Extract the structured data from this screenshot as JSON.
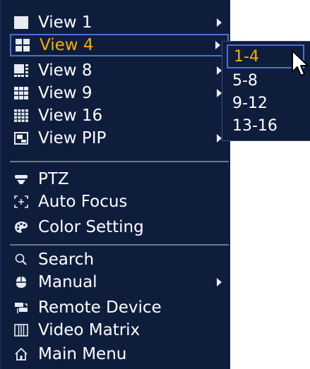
{
  "menu": {
    "items": [
      {
        "label": "View 1",
        "icon": "view-1-icon",
        "has_submenu": true
      },
      {
        "label": "View 4",
        "icon": "view-4-icon",
        "has_submenu": true,
        "active": true
      },
      {
        "label": "View 8",
        "icon": "view-8-icon",
        "has_submenu": true
      },
      {
        "label": "View 9",
        "icon": "view-9-icon",
        "has_submenu": true
      },
      {
        "label": "View 16",
        "icon": "view-16-icon",
        "has_submenu": false
      },
      {
        "label": "View PIP",
        "icon": "view-pip-icon",
        "has_submenu": true
      },
      {
        "label": "PTZ",
        "icon": "ptz-icon",
        "has_submenu": false
      },
      {
        "label": "Auto Focus",
        "icon": "auto-focus-icon",
        "has_submenu": false
      },
      {
        "label": "Color Setting",
        "icon": "color-setting-icon",
        "has_submenu": false
      },
      {
        "label": "Search",
        "icon": "search-icon",
        "has_submenu": false
      },
      {
        "label": "Manual",
        "icon": "manual-icon",
        "has_submenu": true
      },
      {
        "label": "Remote Device",
        "icon": "remote-device-icon",
        "has_submenu": false
      },
      {
        "label": "Video Matrix",
        "icon": "video-matrix-icon",
        "has_submenu": false
      },
      {
        "label": "Main Menu",
        "icon": "main-menu-icon",
        "has_submenu": false
      }
    ]
  },
  "submenu": {
    "items": [
      {
        "label": "1-4",
        "active": true
      },
      {
        "label": "5-8"
      },
      {
        "label": "9-12"
      },
      {
        "label": "13-16"
      }
    ]
  },
  "colors": {
    "background": "#0f1d3d",
    "highlight_border": "#4a6fd6",
    "active_text": "#f2b100",
    "text": "#ffffff"
  }
}
